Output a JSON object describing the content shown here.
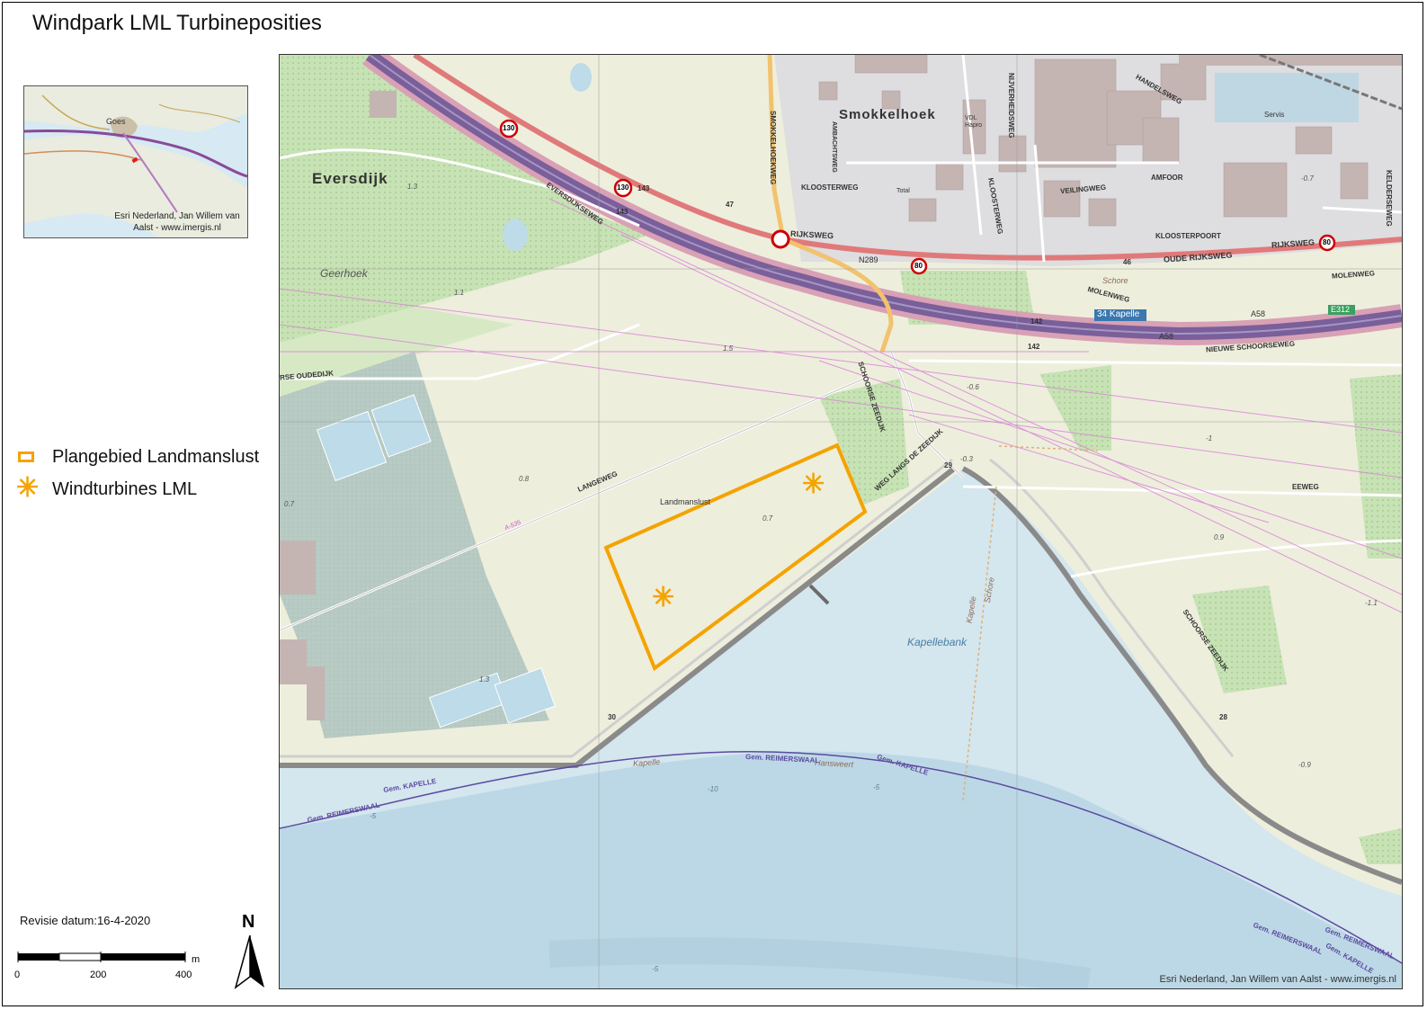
{
  "title": "Windpark LML Turbineposities",
  "inset": {
    "place_label": "Goes",
    "credit": "Esri Nederland, Jan Willem van Aalst - www.imergis.nl"
  },
  "legend": {
    "items": [
      {
        "label": "Plangebied Landmanslust",
        "symbol": "outline-rectangle-icon",
        "color": "#f4a300"
      },
      {
        "label": "Windturbines LML",
        "symbol": "asterisk-icon",
        "color": "#f4a300"
      }
    ]
  },
  "revisie": "Revisie datum:16-4-2020",
  "scalebar": {
    "ticks": [
      "0",
      "200",
      "400"
    ],
    "unit": "m"
  },
  "north_label": "N",
  "map": {
    "credit": "Esri Nederland, Jan Willem van Aalst - www.imergis.nl",
    "places": {
      "smokkelhoek": "Smokkelhoek",
      "eversdijk": "Eversdijk",
      "geerhoek": "Geerhoek",
      "landmanslust": "Landmanslust",
      "kapellebank": "Kapellebank",
      "servis": "Servis",
      "vdl": "VDL Hapro",
      "total": "Total",
      "schore": "Schore",
      "schore2": "Schore",
      "kapelle_water": "Kapelle",
      "hansweert": "Hansweert",
      "kapelle_v": "Kapelle"
    },
    "roads": {
      "rijksweg": "RIJKSWEG",
      "rijksweg2": "RIJKSWEG",
      "n289": "N289",
      "oude_rijksweg": "OUDE RIJKSWEG",
      "molenweg": "MOLENWEG",
      "molenweg2": "MOLENWEG",
      "a58": "A58",
      "a58b": "A58",
      "e312": "E312",
      "kapelle_sign": "34 Kapelle",
      "nieuwe_schoorseweg": "NIEUWE SCHOORSEWEG",
      "schoorse_zeedijk": "SCHOORSE ZEEDIJK",
      "schoorse_zeedijk2": "SCHOORSE ZEEDIJK",
      "weg_langs": "WEG LANGS DE ZEEDIJK",
      "langeweg": "LANGEWEG",
      "eversdijkseweg": "EVERSDIJKSEWEG",
      "smokkelhoekweg": "SMOKKELHOEKWEG",
      "kloosterweg": "KLOOSTERWEG",
      "kloosterweg2": "KLOOSTERWEG",
      "veilingweg": "VEILINGWEG",
      "amfoor": "AMFOOR",
      "kloosterpoort": "KLOOSTERPOORT",
      "nijverheidsweg": "NIJVERHEIDSWEG",
      "handelsweg": "HANDELSWEG",
      "oudedijk": "RSE OUDEDIJK",
      "eeweg": "EEWEG",
      "kelderseweg": "KELDERSEWEG",
      "ambachtsweg": "AMBACHTSWEG",
      "a535": "A-535"
    },
    "boundaries": {
      "gem_kapelle": "Gem. KAPELLE",
      "gem_reimerswaal": "Gem. REIMERSWAAL",
      "gem_kapelle2": "Gem. KAPELLE",
      "gem_reimerswaal2": "Gem. REIMERSWAAL",
      "gem_reimerswaal3": "Gem. REIMERSWAAL",
      "gem_kapelle3": "Gem. KAPELLE",
      "gem_reimerswaal4": "Gem. REIMERSWAAL"
    },
    "shields": {
      "s130a": "130",
      "s130b": "130",
      "s80a": "80",
      "s80b": "80"
    },
    "numbers": {
      "n143a": "143",
      "n143b": "143",
      "n47": "47",
      "n46": "46",
      "n142a": "142",
      "n142b": "142",
      "n29": "29",
      "n30": "30",
      "n28": "28"
    },
    "elevations": {
      "e1": "1.3",
      "e2": "1.1",
      "e3": "1.5",
      "e4": "0.8",
      "e5": "0.7",
      "e6": "0.7",
      "e7": "1.3",
      "e8": "-0.6",
      "e9": "-1",
      "e10": "0.9",
      "e11": "-1.1",
      "e12": "-0.9",
      "e13": "-0.7",
      "e14": "-0.3",
      "d1": "-10",
      "d2": "-5",
      "d3": "-5",
      "d4": "-5"
    },
    "turbines": [
      {
        "id": "T1"
      },
      {
        "id": "T2"
      }
    ]
  }
}
